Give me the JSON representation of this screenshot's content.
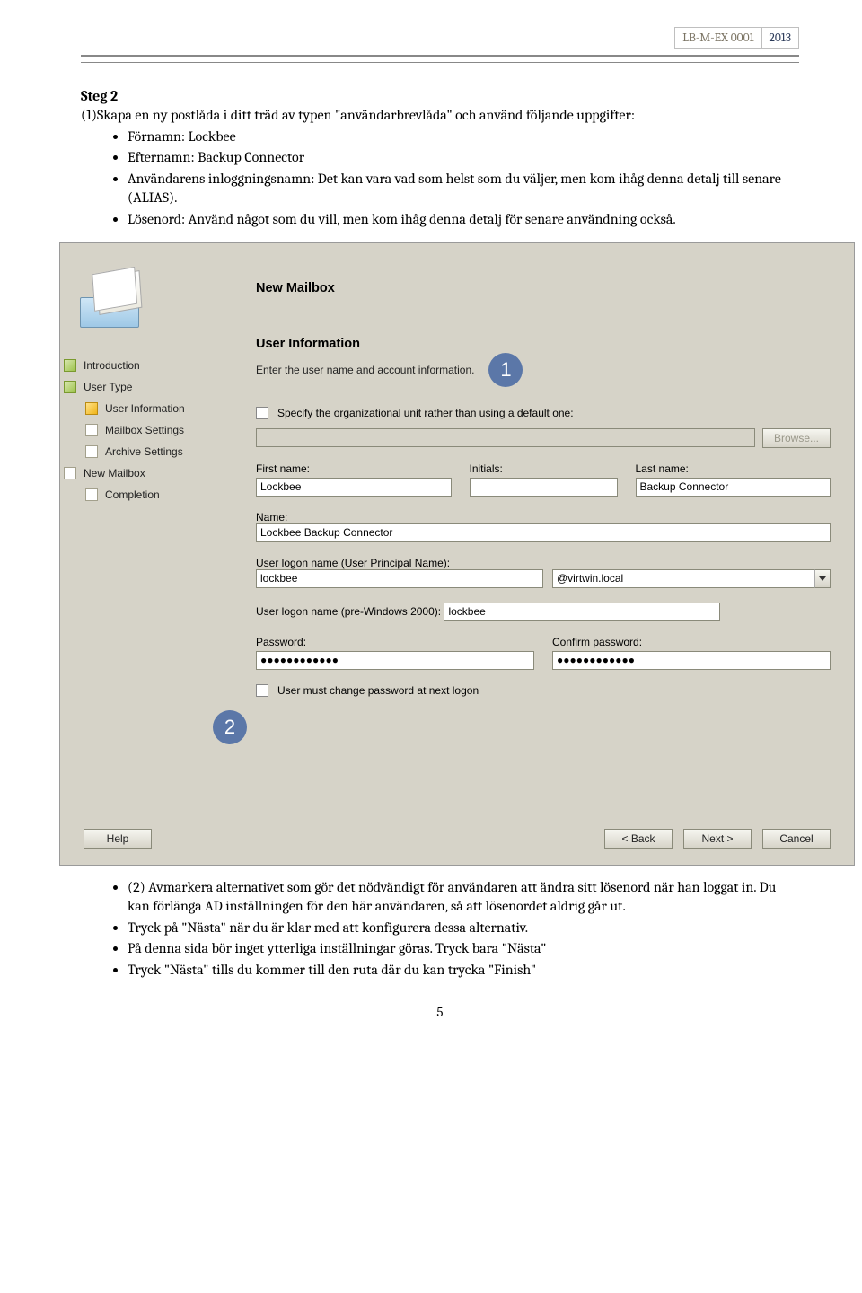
{
  "header": {
    "code": "LB-M-EX 0001",
    "year": "2013"
  },
  "step2": {
    "title": "Steg 2",
    "intro": "(1)Skapa en ny postlåda i ditt träd av typen \"användarbrevlåda\" och använd följande uppgifter:",
    "bullets": [
      "Förnamn: Lockbee",
      "Efternamn: Backup Connector",
      "Användarens inloggningsnamn: Det kan vara vad som helst som du väljer, men kom ihåg denna detalj till senare (ALIAS).",
      "Lösenord: Använd något som du vill, men kom ihåg denna detalj för senare användning också."
    ]
  },
  "wizard": {
    "title": "New Mailbox",
    "nav": {
      "intro": "Introduction",
      "utype": "User Type",
      "uinfo": "User Information",
      "mbs": "Mailbox Settings",
      "arch": "Archive Settings",
      "newmb": "New Mailbox",
      "comp": "Completion"
    },
    "section_title": "User Information",
    "section_sub": "Enter the user name and account information.",
    "callout1": "1",
    "callout2": "2",
    "specify_ou": "Specify the organizational unit rather than using a default one:",
    "browse": "Browse...",
    "first_name_lbl": "First name:",
    "first_name": "Lockbee",
    "initials_lbl": "Initials:",
    "initials": "",
    "last_name_lbl": "Last name:",
    "last_name": "Backup Connector",
    "name_lbl": "Name:",
    "name": "Lockbee Backup Connector",
    "upn_lbl": "User logon name (User Principal Name):",
    "upn": "lockbee",
    "upn_domain": "@virtwin.local",
    "pre2000_lbl": "User logon name (pre-Windows 2000):",
    "pre2000": "lockbee",
    "pw_lbl": "Password:",
    "pw": "●●●●●●●●●●●●",
    "cpw_lbl": "Confirm password:",
    "cpw": "●●●●●●●●●●●●",
    "must_change": "User must change password at next logon",
    "buttons": {
      "help": "Help",
      "back": "< Back",
      "next": "Next >",
      "cancel": "Cancel"
    }
  },
  "after": [
    "(2) Avmarkera alternativet som gör det nödvändigt för användaren att ändra sitt lösenord när han loggat in. Du kan förlänga AD inställningen för den här användaren, så att lösenordet aldrig går ut.",
    "Tryck på \"Nästa\" när du är klar med att konfigurera dessa alternativ.",
    "På denna sida bör inget ytterliga inställningar göras. Tryck bara \"Nästa\"",
    "Tryck \"Nästa\" tills du kommer till den ruta där du kan trycka \"Finish\""
  ],
  "pagenum": "5"
}
